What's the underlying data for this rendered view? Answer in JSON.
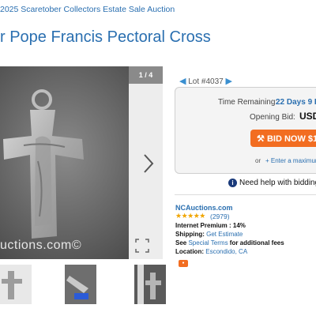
{
  "breadcrumb": "2025 Scaretober Collectors Estate Sale Auction",
  "title": "r Pope Francis Pectoral Cross",
  "gallery": {
    "counter": "1 / 4",
    "watermark": "uctions.com©",
    "next_icon": "chevron-right-icon",
    "expand_icon": "expand-icon"
  },
  "thumbnails": [
    "thumbnail-1",
    "thumbnail-2",
    "thumbnail-3"
  ],
  "lot": {
    "label": "Lot #4037"
  },
  "bidding": {
    "time_remaining_label": "Time Remaining:",
    "time_remaining_value": "22 Days 9 H",
    "opening_bid_label": "Opening Bid:",
    "opening_bid_value": "USD",
    "bid_button": "BID NOW $1",
    "or": "or",
    "max_bid_link": "+ Enter a maximum"
  },
  "help": {
    "text": "Need help with bidding"
  },
  "seller": {
    "name": "NCAuctions.com",
    "stars": "★★★★★",
    "reviews": "(2979)",
    "premium": "Internet Premium : 14%",
    "shipping_label": "Shipping:",
    "shipping_link": "Get Estimate",
    "see_label": "See",
    "special_terms_link": "Special Terms",
    "terms_suffix": "for additional fees",
    "location_label": "Location:",
    "location_value": "Escondido, CA"
  },
  "colors": {
    "link": "#2a6fb0",
    "bid_button": "#f26d21",
    "panel": "#f4f4f4",
    "stars": "#f0a500"
  }
}
